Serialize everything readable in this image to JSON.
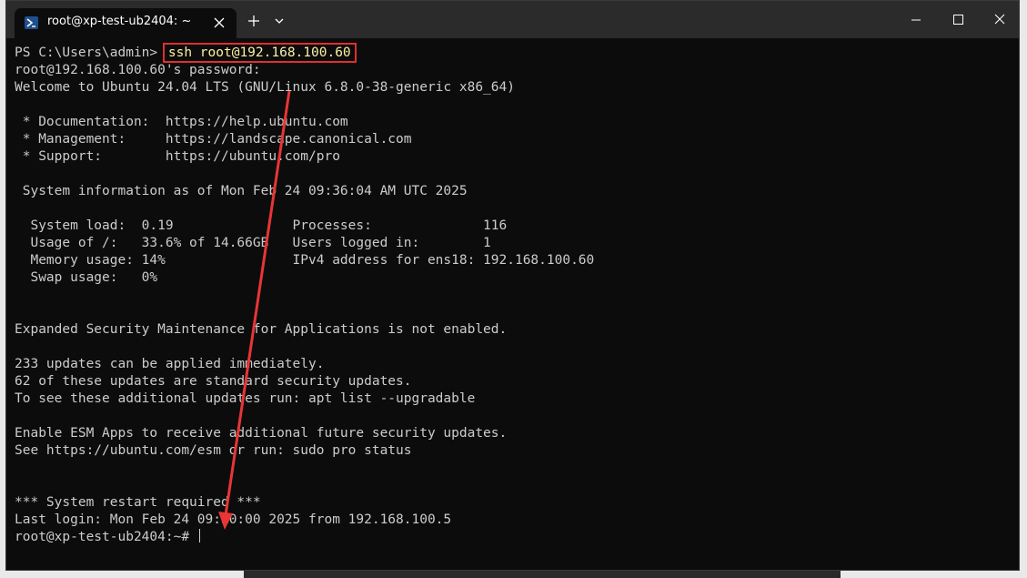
{
  "window": {
    "tab_title": "root@xp-test-ub2404: ~",
    "tab_icon": "powershell-icon",
    "controls": [
      "minimize-icon",
      "maximize-icon",
      "close-icon"
    ]
  },
  "colors": {
    "terminal_bg": "#0c0c0c",
    "terminal_text": "#cccccc",
    "command_text": "#f9f1a5",
    "highlight_border": "#e03030",
    "annotation_arrow": "#e83535"
  },
  "terminal": {
    "prompt": "PS C:\\Users\\admin> ",
    "command": "ssh root@192.168.100.60",
    "lines": [
      "root@192.168.100.60's password:",
      "Welcome to Ubuntu 24.04 LTS (GNU/Linux 6.8.0-38-generic x86_64)",
      "",
      " * Documentation:  https://help.ubuntu.com",
      " * Management:     https://landscape.canonical.com",
      " * Support:        https://ubuntu.com/pro",
      "",
      " System information as of Mon Feb 24 09:36:04 AM UTC 2025",
      "",
      "  System load:  0.19               Processes:              116",
      "  Usage of /:   33.6% of 14.66GB   Users logged in:        1",
      "  Memory usage: 14%                IPv4 address for ens18: 192.168.100.60",
      "  Swap usage:   0%",
      "",
      "",
      "Expanded Security Maintenance for Applications is not enabled.",
      "",
      "233 updates can be applied immediately.",
      "62 of these updates are standard security updates.",
      "To see these additional updates run: apt list --upgradable",
      "",
      "Enable ESM Apps to receive additional future security updates.",
      "See https://ubuntu.com/esm or run: sudo pro status",
      "",
      "",
      "*** System restart required ***",
      "Last login: Mon Feb 24 09:30:00 2025 from 192.168.100.5"
    ],
    "final_prompt": "root@xp-test-ub2404:~# "
  }
}
